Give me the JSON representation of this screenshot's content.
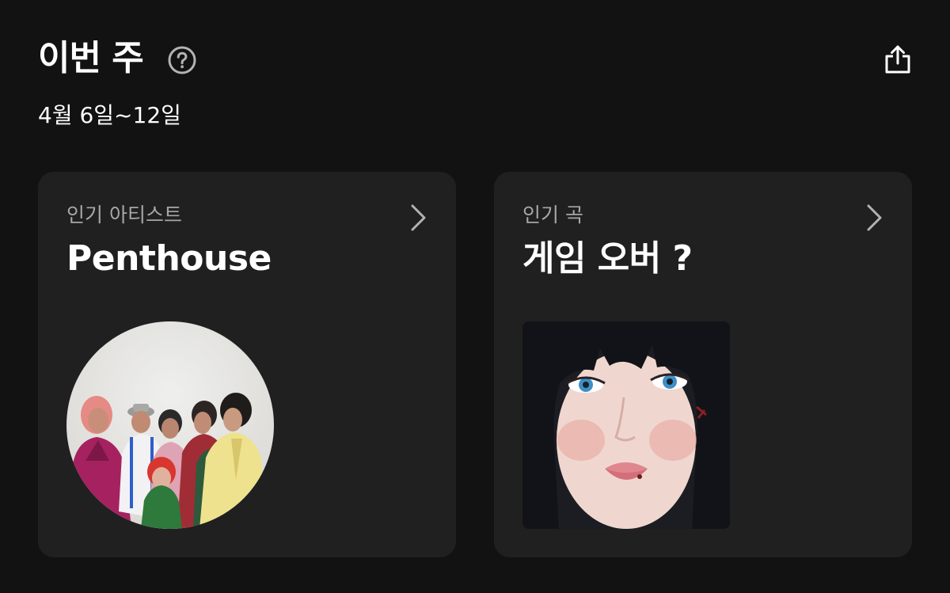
{
  "header": {
    "title": "이번 주",
    "date_range": "4월 6일~12일",
    "help_icon": "question-circle-icon",
    "share_icon": "share-icon"
  },
  "cards": [
    {
      "label": "인기 아티스트",
      "title": "Penthouse",
      "image": "artist-photo",
      "chevron_icon": "chevron-right-icon"
    },
    {
      "label": "인기 곡",
      "title": "게임 오버 ?",
      "image": "album-cover",
      "chevron_icon": "chevron-right-icon"
    }
  ],
  "colors": {
    "background": "#121212",
    "card": "#202020",
    "muted_text": "#a7a7a7",
    "text": "#ffffff"
  }
}
